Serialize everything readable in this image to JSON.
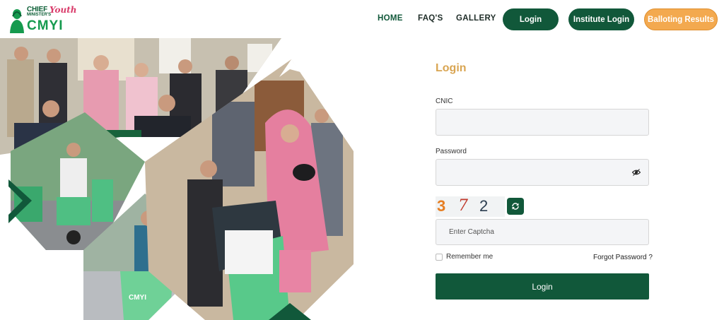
{
  "header": {
    "logo": {
      "line1": "CHIEF",
      "line1_sub": "MINISTER'S",
      "youth": "Youth",
      "line2": "CMYI"
    },
    "nav": [
      {
        "label": "HOME",
        "active": true
      },
      {
        "label": "FAQ'S",
        "active": false
      },
      {
        "label": "GALLERY",
        "active": false
      }
    ],
    "buttons": {
      "login": "Login",
      "institute_login": "Institute Login",
      "balloting_results": "Balloting Results"
    }
  },
  "hero": {
    "scooter_label": "CMYI"
  },
  "form": {
    "title": "Login",
    "cnic_label": "CNIC",
    "cnic_value": "",
    "password_label": "Password",
    "password_value": "",
    "captcha": [
      "3",
      "7",
      "2"
    ],
    "captcha_placeholder": "Enter Captcha",
    "remember_label": "Remember me",
    "forgot_label": "Forgot Password ?",
    "submit_label": "Login"
  },
  "icons": {
    "eye": "eye-icon",
    "refresh": "refresh-icon"
  },
  "colors": {
    "brand_green": "#11583a",
    "accent_orange": "#f3a94f",
    "title_gold": "#d9a552",
    "scooter_mint": "#5fcf8e"
  }
}
